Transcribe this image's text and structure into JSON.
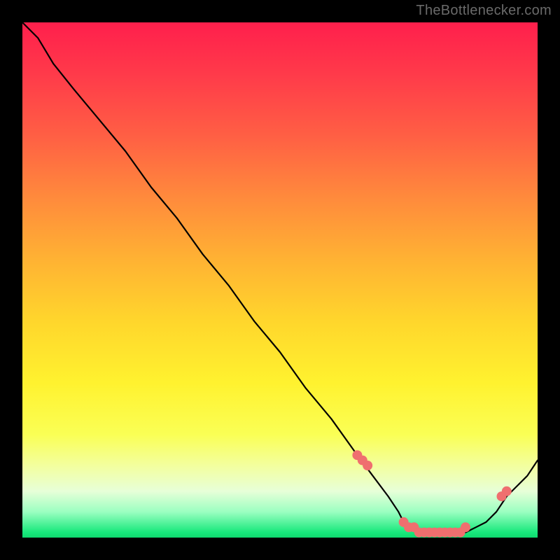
{
  "attribution": "TheBottlenecker.com",
  "chart_data": {
    "type": "line",
    "title": "",
    "xlabel": "",
    "ylabel": "",
    "xlim": [
      0,
      100
    ],
    "ylim": [
      0,
      100
    ],
    "x": [
      0,
      3,
      6,
      10,
      15,
      20,
      25,
      30,
      35,
      40,
      45,
      50,
      55,
      60,
      65,
      68,
      71,
      73,
      74,
      76,
      78,
      80,
      82,
      84,
      86,
      88,
      90,
      92,
      94,
      96,
      98,
      100
    ],
    "y": [
      100,
      97,
      92,
      87,
      81,
      75,
      68,
      62,
      55,
      49,
      42,
      36,
      29,
      23,
      16,
      12,
      8,
      5,
      3,
      2,
      1,
      1,
      1,
      1,
      1,
      2,
      3,
      5,
      8,
      10,
      12,
      15
    ],
    "markers_x": [
      65,
      66,
      67,
      74,
      75,
      76,
      77,
      78,
      79,
      80,
      81,
      82,
      83,
      84,
      85,
      86,
      93,
      94
    ],
    "markers_y": [
      16,
      15,
      14,
      3,
      2,
      2,
      1,
      1,
      1,
      1,
      1,
      1,
      1,
      1,
      1,
      2,
      8,
      9
    ],
    "colors": {
      "line": "#000000",
      "markers": "#ef6f6f"
    }
  }
}
